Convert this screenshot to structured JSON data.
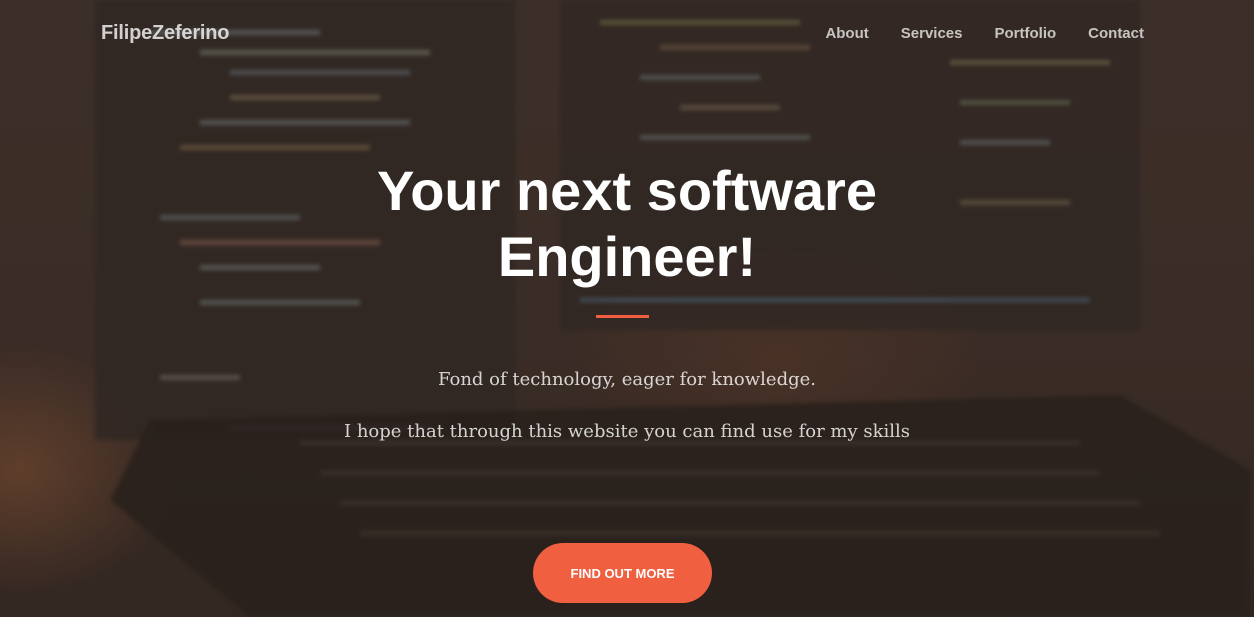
{
  "navbar": {
    "brand": "FilipeZeferino",
    "links": [
      {
        "label": "About"
      },
      {
        "label": "Services"
      },
      {
        "label": "Portfolio"
      },
      {
        "label": "Contact"
      }
    ]
  },
  "hero": {
    "headline_line1": "Your next software",
    "headline_line2": "Engineer!",
    "subtext_1": "Fond of technology, eager for knowledge.",
    "subtext_2": "I hope that through this website you can find use for my skills",
    "cta_label": "FIND OUT MORE"
  },
  "colors": {
    "accent": "#f05f40",
    "text_primary": "#ffffff",
    "background_tint": "#3a2e2a"
  }
}
